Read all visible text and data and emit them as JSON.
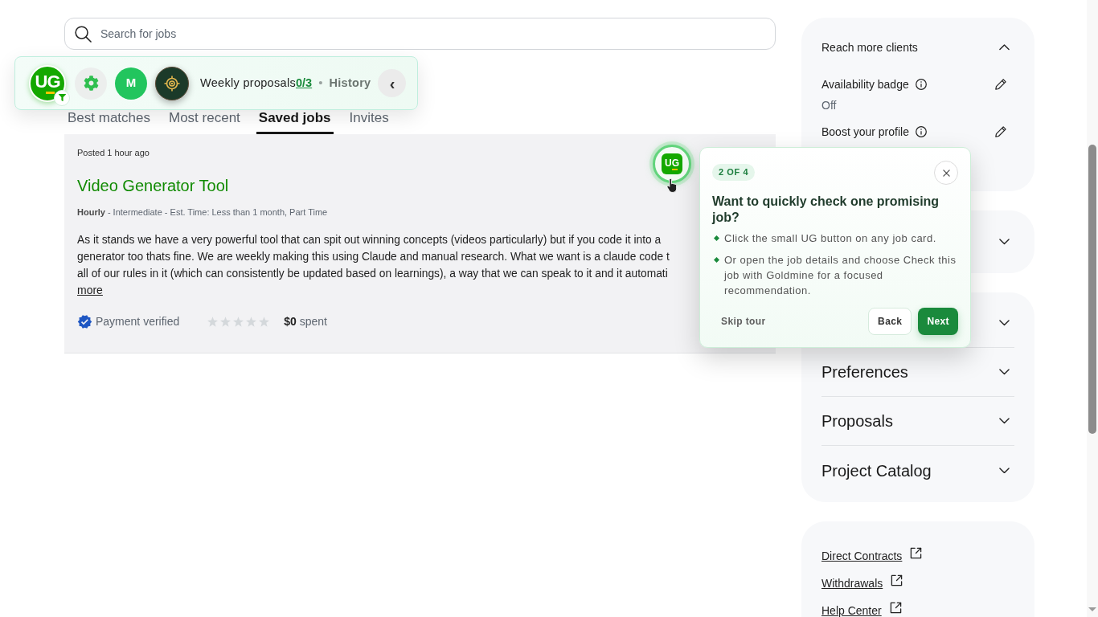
{
  "search": {
    "placeholder": "Search for jobs"
  },
  "toolbar": {
    "avatar": "UG",
    "initial": "M",
    "label": "Weekly proposals",
    "count": "0/3",
    "separator": "•",
    "history": "History",
    "collapse": "‹"
  },
  "tabs": [
    {
      "label": "Best matches",
      "selected": false
    },
    {
      "label": "Most recent",
      "selected": false
    },
    {
      "label": "Saved jobs",
      "selected": true
    },
    {
      "label": "Invites",
      "selected": false
    }
  ],
  "job": {
    "posted": "Posted 1 hour ago",
    "title": "Video Generator Tool",
    "meta": "**Hourly** - Intermediate - Est. Time: Less than 1 month, Part Time",
    "description": [
      "As it stands we have a very powerful tool that can spit out winning concepts (videos particularly) but if you code it into a",
      "generator too thats fine. We are weekly making this using Claude and manual research. What we want is a claude code t",
      "all of our rules in it (which can consistently be updated based on learnings), a way that we can speak to it and it automati"
    ],
    "more": "more",
    "payment": "Payment verified",
    "stars": 0,
    "spent": "**$0** spent",
    "check_button": "UG"
  },
  "tour": {
    "step": "2 OF 4",
    "title": "Want to quickly check one promising job?",
    "tips": [
      "Click the small UG button on any job card.",
      "Or open the job details and choose Check this job with Goldmine for a focused recommendation."
    ],
    "skip": "Skip tour",
    "back": "Back",
    "next": "Next"
  },
  "sidebar": {
    "reach": {
      "title": "Reach more clients",
      "expanded": true,
      "items": [
        {
          "label": "Availability badge",
          "value": "Off"
        },
        {
          "label": "Boost your profile"
        }
      ]
    },
    "connects": {
      "expanded": false
    },
    "sections": [
      {
        "expanded": false
      },
      {
        "title": "Preferences",
        "expanded": false
      },
      {
        "title": "Proposals",
        "expanded": false
      },
      {
        "title": "Project Catalog",
        "expanded": false
      }
    ],
    "links": [
      "Direct Contracts",
      "Withdrawals",
      "Help Center"
    ]
  }
}
